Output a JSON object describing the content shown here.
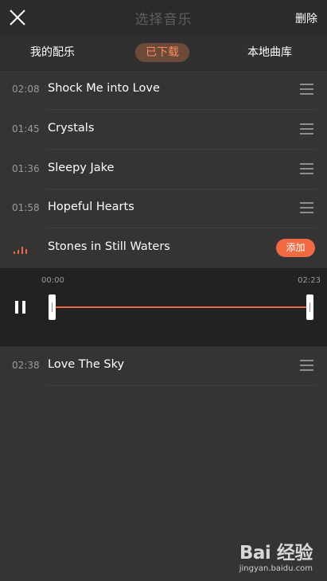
{
  "header": {
    "title": "选择音乐",
    "delete_label": "删除"
  },
  "tabs": [
    {
      "label": "我的配乐",
      "active": false
    },
    {
      "label": "已下载",
      "active": true
    },
    {
      "label": "本地曲库",
      "active": false
    }
  ],
  "songs": [
    {
      "duration": "02:08",
      "name": "Shock Me into Love"
    },
    {
      "duration": "01:45",
      "name": "Crystals"
    },
    {
      "duration": "01:36",
      "name": "Sleepy Jake"
    },
    {
      "duration": "01:58",
      "name": "Hopeful Hearts"
    },
    {
      "duration": "",
      "name": "Stones in Still Waters",
      "playing": true
    },
    {
      "duration": "02:38",
      "name": "Love The Sky"
    }
  ],
  "add_label": "添加",
  "player": {
    "start_time": "00:00",
    "end_time": "02:23"
  },
  "watermark": {
    "logo": "Bai 经验",
    "url": "jingyan.baidu.com"
  },
  "colors": {
    "accent": "#f06a44",
    "background": "#343434",
    "header_bg": "#2b2b2b",
    "player_bg": "#222222"
  },
  "icons": {
    "close": "close-icon",
    "drag": "drag-handle-icon",
    "playing": "playing-bars-icon",
    "pause": "pause-icon"
  }
}
